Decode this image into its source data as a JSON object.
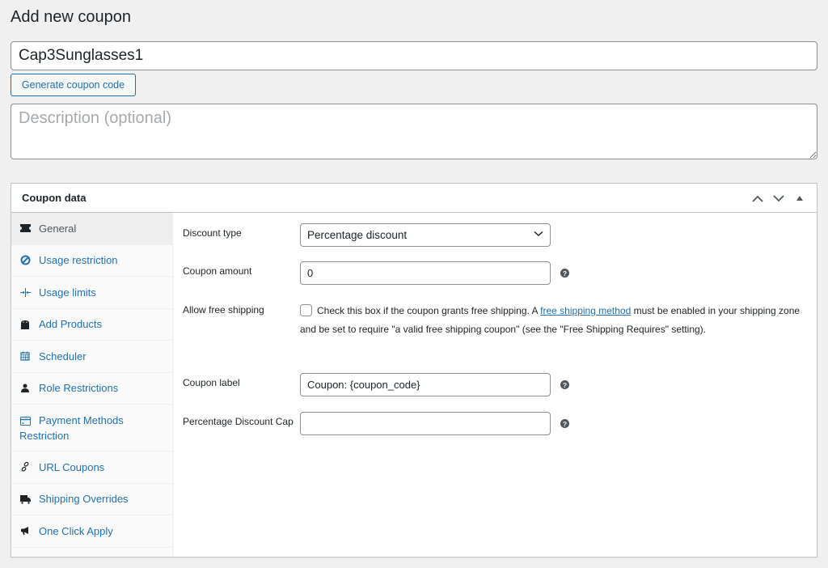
{
  "page": {
    "title": "Add new coupon",
    "coupon_code": "Cap3Sunglasses1",
    "generate_button": "Generate coupon code",
    "description_placeholder": "Description (optional)",
    "description_value": ""
  },
  "panel": {
    "title": "Coupon data",
    "controls": {
      "move_up": "move-up",
      "move_down": "move-down",
      "toggle": "toggle-panel"
    },
    "tabs": [
      {
        "label": "General",
        "icon": "ticket-icon",
        "active": true
      },
      {
        "label": "Usage restriction",
        "icon": "block-icon",
        "active": false
      },
      {
        "label": "Usage limits",
        "icon": "limits-icon",
        "active": false
      },
      {
        "label": "Add Products",
        "icon": "bag-icon",
        "active": false
      },
      {
        "label": "Scheduler",
        "icon": "calendar-icon",
        "active": false
      },
      {
        "label": "Role Restrictions",
        "icon": "user-icon",
        "active": false
      },
      {
        "label": "Payment Methods Restriction",
        "icon": "card-icon",
        "active": false
      },
      {
        "label": "URL Coupons",
        "icon": "link-icon",
        "active": false
      },
      {
        "label": "Shipping Overrides",
        "icon": "truck-icon",
        "active": false
      },
      {
        "label": "One Click Apply",
        "icon": "megaphone-icon",
        "active": false
      }
    ],
    "general": {
      "discount_type": {
        "label": "Discount type",
        "value": "Percentage discount"
      },
      "coupon_amount": {
        "label": "Coupon amount",
        "value": "0"
      },
      "free_shipping": {
        "label": "Allow free shipping",
        "checked": false,
        "text_before": "Check this box if the coupon grants free shipping. A ",
        "link_text": "free shipping method",
        "text_after": " must be enabled in your shipping zone and be set to require \"a valid free shipping coupon\" (see the \"Free Shipping Requires\" setting)."
      },
      "coupon_label": {
        "label": "Coupon label",
        "value": "Coupon: {coupon_code}"
      },
      "percentage_cap": {
        "label": "Percentage Discount Cap",
        "value": ""
      }
    }
  }
}
